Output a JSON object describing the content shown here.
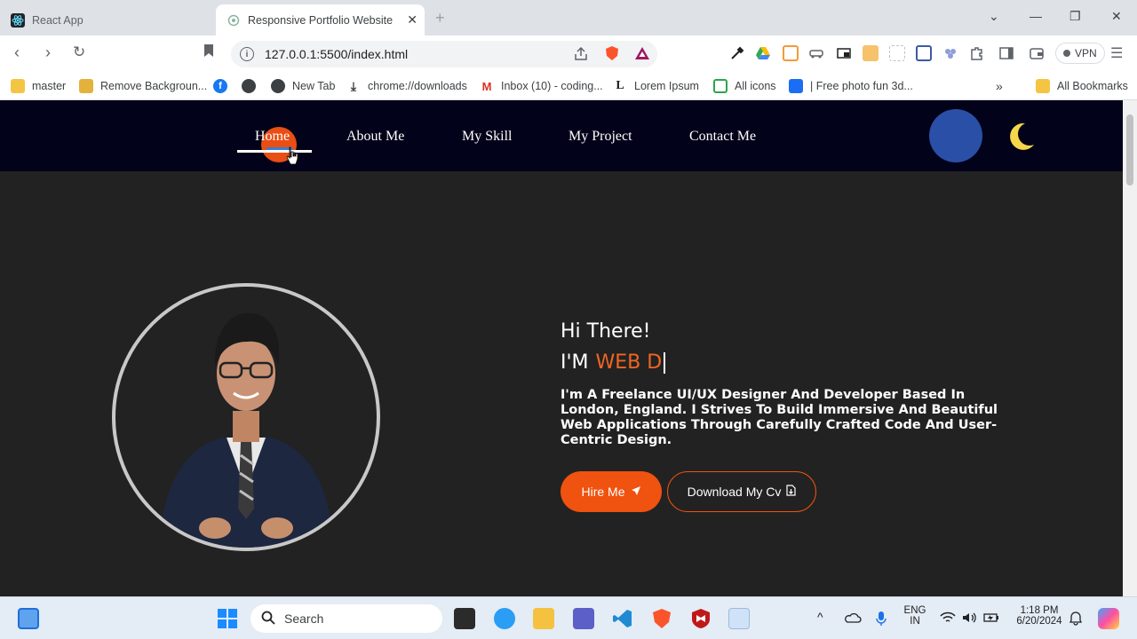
{
  "browser": {
    "tabs": [
      {
        "title": "React App",
        "active": false,
        "icon": "react-icon"
      },
      {
        "title": "Responsive Portfolio Website",
        "active": true,
        "icon": "globe-loading-icon"
      }
    ],
    "url": "127.0.0.1:5500/index.html",
    "vpn_label": "VPN",
    "bookmarks": [
      {
        "label": "master",
        "icon": "folder-icon"
      },
      {
        "label": "Remove Backgroun...",
        "icon": "remove-bg-icon"
      },
      {
        "label": "",
        "icon": "facebook-icon"
      },
      {
        "label": "",
        "icon": "globe-icon"
      },
      {
        "label": "New Tab",
        "icon": "globe-icon"
      },
      {
        "label": "chrome://downloads",
        "icon": "download-icon"
      },
      {
        "label": "Inbox (10) - coding...",
        "icon": "gmail-icon"
      },
      {
        "label": "Lorem Ipsum",
        "icon": "lorem-icon"
      },
      {
        "label": "All icons",
        "icon": "icons-icon"
      },
      {
        "label": "| Free photo fun 3d...",
        "icon": "freepik-icon"
      }
    ],
    "all_bookmarks": "All Bookmarks"
  },
  "site": {
    "nav": {
      "home": "Home",
      "about": "About Me",
      "skill": "My Skill",
      "project": "My Project",
      "contact": "Contact Me"
    },
    "hero": {
      "greeting": "Hi There!",
      "im": "I'M",
      "typed": "WEB D",
      "description": "I'm A Freelance UI/UX Designer And Developer Based In London, England. I Strives To Build Immersive And Beautiful Web Applications Through Carefully Crafted Code And User-Centric Design.",
      "hire_button": "Hire Me",
      "cv_button": "Download My Cv"
    },
    "colors": {
      "accent": "#f0520f",
      "nav_bg": "#02021a",
      "page_bg": "#222222"
    }
  },
  "taskbar": {
    "search_placeholder": "Search",
    "language": "ENG",
    "region": "IN",
    "time": "1:18 PM",
    "date": "6/20/2024"
  }
}
